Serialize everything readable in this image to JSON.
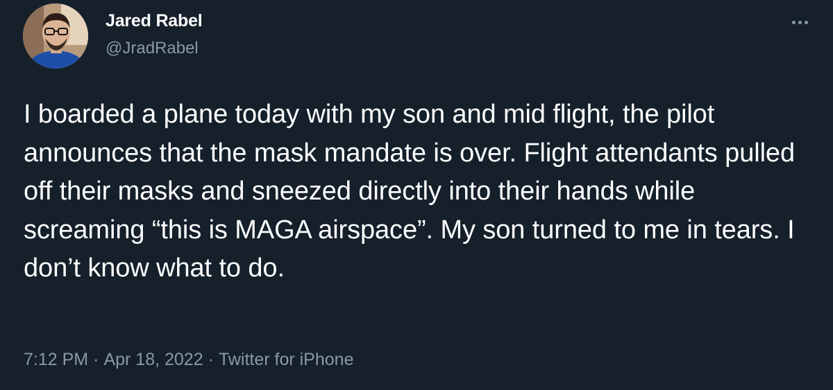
{
  "tweet": {
    "author": {
      "display_name": "Jared Rabel",
      "handle": "@JradRabel"
    },
    "more_icon": "more-horizontal-icon",
    "text": "I boarded a plane today with my son and mid flight, the pilot announces that the mask mandate is over. Flight attendants pulled off their masks and sneezed directly into their hands while screaming “this is MAGA airspace”. My son turned to me in tears. I don’t know what to do.",
    "time": "7:12 PM",
    "date": "Apr 18, 2022",
    "source": "Twitter for iPhone",
    "separator": "·"
  },
  "colors": {
    "background": "#15202b",
    "text_primary": "#ffffff",
    "text_secondary": "#8b98a5"
  }
}
